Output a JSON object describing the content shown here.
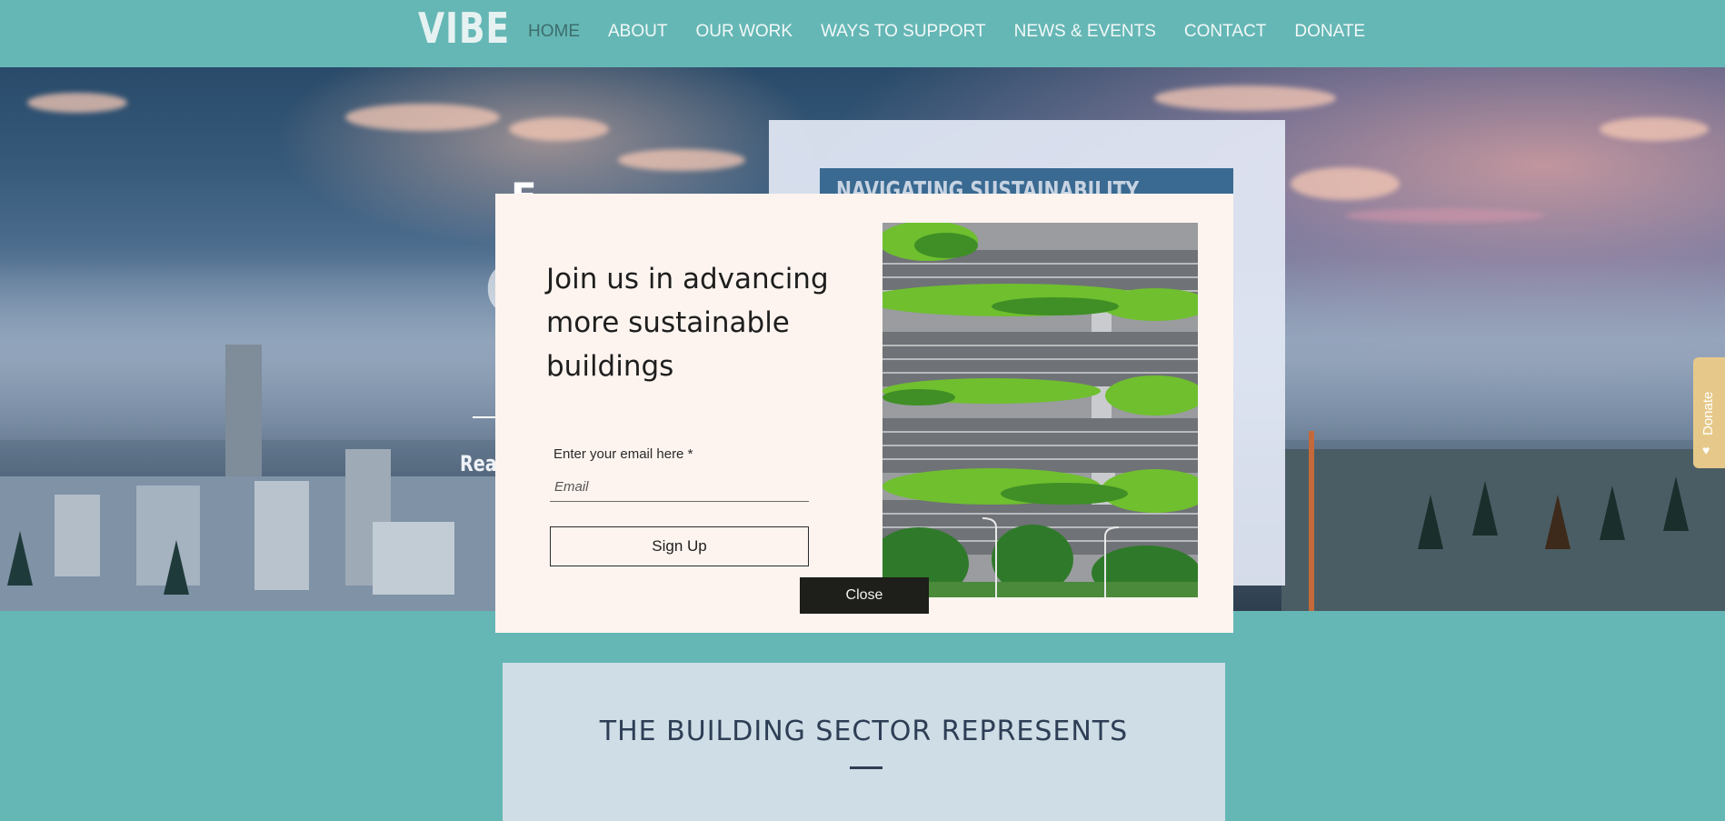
{
  "header": {
    "logo": "VIBE",
    "nav": [
      {
        "label": "HOME",
        "active": true
      },
      {
        "label": "ABOUT"
      },
      {
        "label": "OUR WORK"
      },
      {
        "label": "WAYS TO SUPPORT"
      },
      {
        "label": "NEWS & EVENTS"
      },
      {
        "label": "CONTACT"
      },
      {
        "label": "DONATE"
      }
    ]
  },
  "hero": {
    "fragment_e": "E",
    "fragment_c": "C",
    "fragment_read": "Rea"
  },
  "card": {
    "title": "NAVIGATING SUSTAINABILITY"
  },
  "donate_tab": {
    "label": "Donate",
    "icon": "heart-icon"
  },
  "popup": {
    "heading": "Join us in advancing more sustainable buildings",
    "email_label": "Enter your email here *",
    "email_placeholder": "Email",
    "email_value": "",
    "signup_label": "Sign Up",
    "close_label": "Close",
    "image": "green-terraced-building"
  },
  "section": {
    "heading": "THE BUILDING SECTOR REPRESENTS"
  },
  "colors": {
    "header_bg": "#65b7b5",
    "popup_bg": "#fdf4ef",
    "stat_panel_bg": "#cfdde6",
    "donate_tab_bg": "#e6c98a",
    "close_button_bg": "#1e1e1a"
  }
}
